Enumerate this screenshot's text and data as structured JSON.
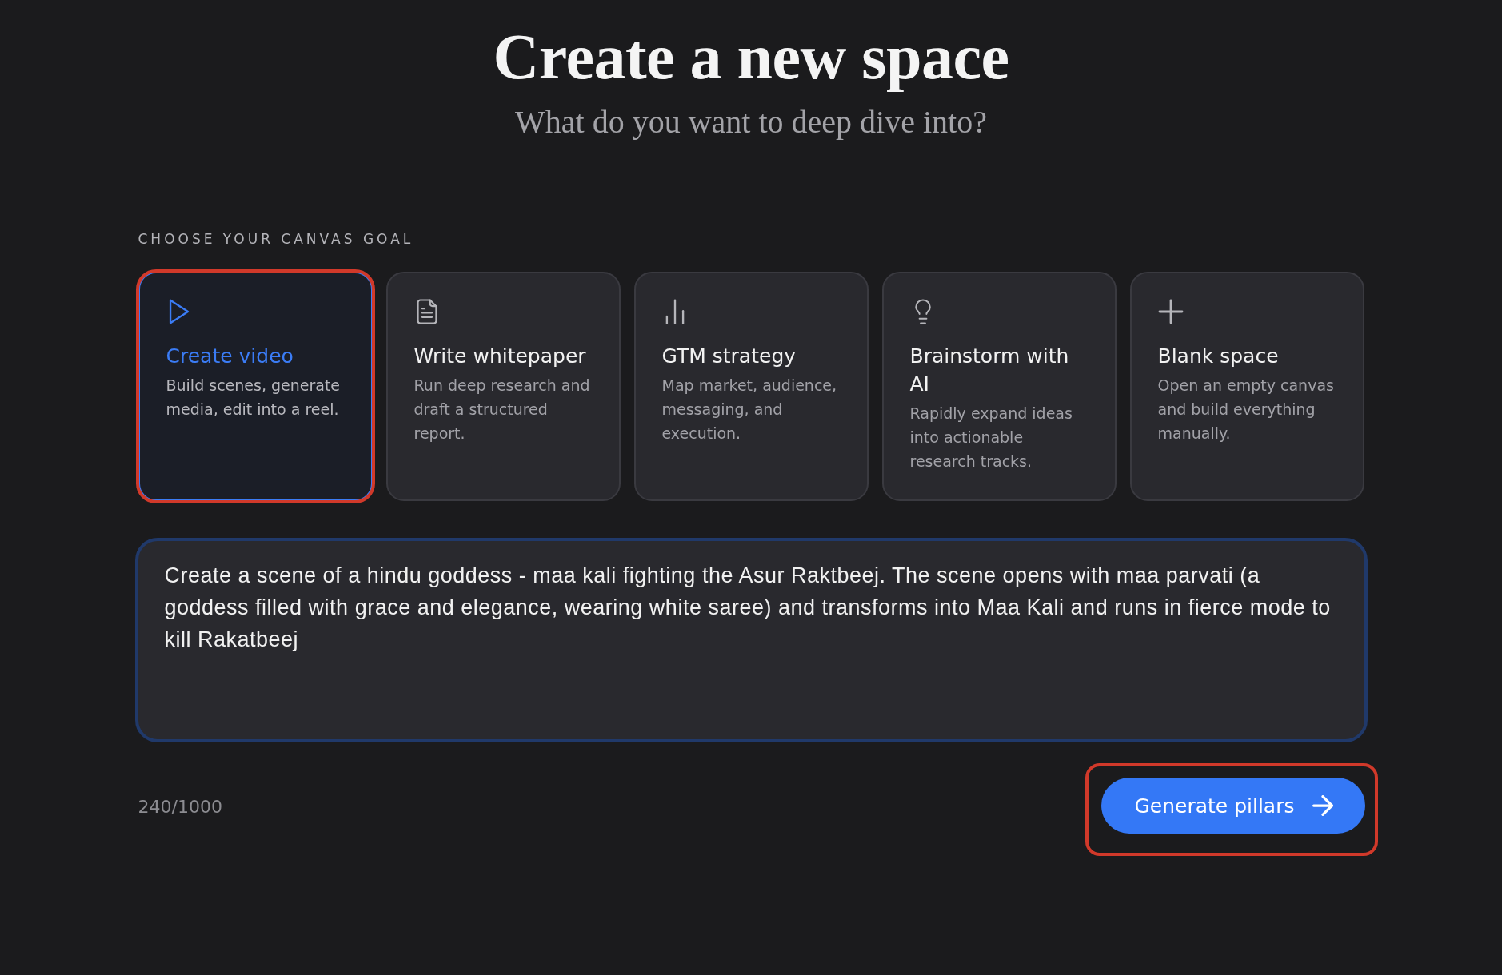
{
  "header": {
    "title": "Create a new space",
    "subtitle": "What do you want to deep dive into?"
  },
  "goal_section": {
    "label": "CHOOSE YOUR CANVAS GOAL",
    "cards": [
      {
        "kind": "video",
        "title": "Create video",
        "description": "Build scenes, generate media, edit into a reel.",
        "selected": true,
        "highlighted": true
      },
      {
        "kind": "document",
        "title": "Write whitepaper",
        "description": "Run deep research and draft a structured report.",
        "selected": false,
        "highlighted": false
      },
      {
        "kind": "chart",
        "title": "GTM strategy",
        "description": "Map market, audience, messaging, and execution.",
        "selected": false,
        "highlighted": false
      },
      {
        "kind": "idea",
        "title": "Brainstorm with AI",
        "description": "Rapidly expand ideas into actionable research tracks.",
        "selected": false,
        "highlighted": false
      },
      {
        "kind": "blank",
        "title": "Blank space",
        "description": "Open an empty canvas and build everything manually.",
        "selected": false,
        "highlighted": false
      }
    ]
  },
  "prompt": {
    "value": "Create a scene of a hindu goddess - maa kali fighting the Asur Raktbeej. The scene opens with maa parvati (a goddess filled with grace and elegance, wearing white saree) and transforms into Maa Kali and runs in fierce mode to kill Rakatbeej"
  },
  "footer": {
    "counter": "240/1000",
    "button": {
      "label": "Generate pillars",
      "highlighted": true
    }
  }
}
